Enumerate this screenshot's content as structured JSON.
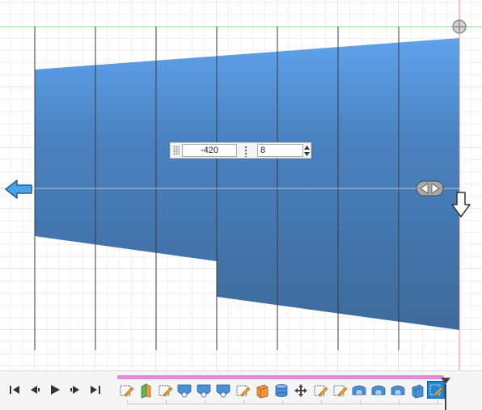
{
  "sketch": {
    "dimension_value": "-420",
    "angle_value": "8",
    "colors": {
      "profile_top": "#5ea3ec",
      "profile_bottom": "#3d6a9a",
      "grid_minor": "#e6e6e6",
      "grid_major": "#d2d2d2",
      "x_axis": "#9ee69e",
      "y_axis": "#f0a0a0",
      "arrow_fill": "#4aa3e6"
    }
  },
  "toolbar": {
    "playback": [
      "skip-to-start-icon",
      "step-back-icon",
      "play-icon",
      "step-forward-icon",
      "skip-to-end-icon"
    ],
    "timeline_features": [
      "sketch-icon",
      "extrude-icon",
      "sketch-icon",
      "fillet-icon",
      "fillet-icon",
      "fillet-icon",
      "sketch-icon",
      "box-icon",
      "cylinder-icon",
      "move-icon",
      "sketch-icon",
      "sketch-icon",
      "split-body-icon",
      "split-body-icon",
      "split-body-icon",
      "box-icon",
      "active-sketch-icon"
    ],
    "accent": "#e38ad9"
  }
}
